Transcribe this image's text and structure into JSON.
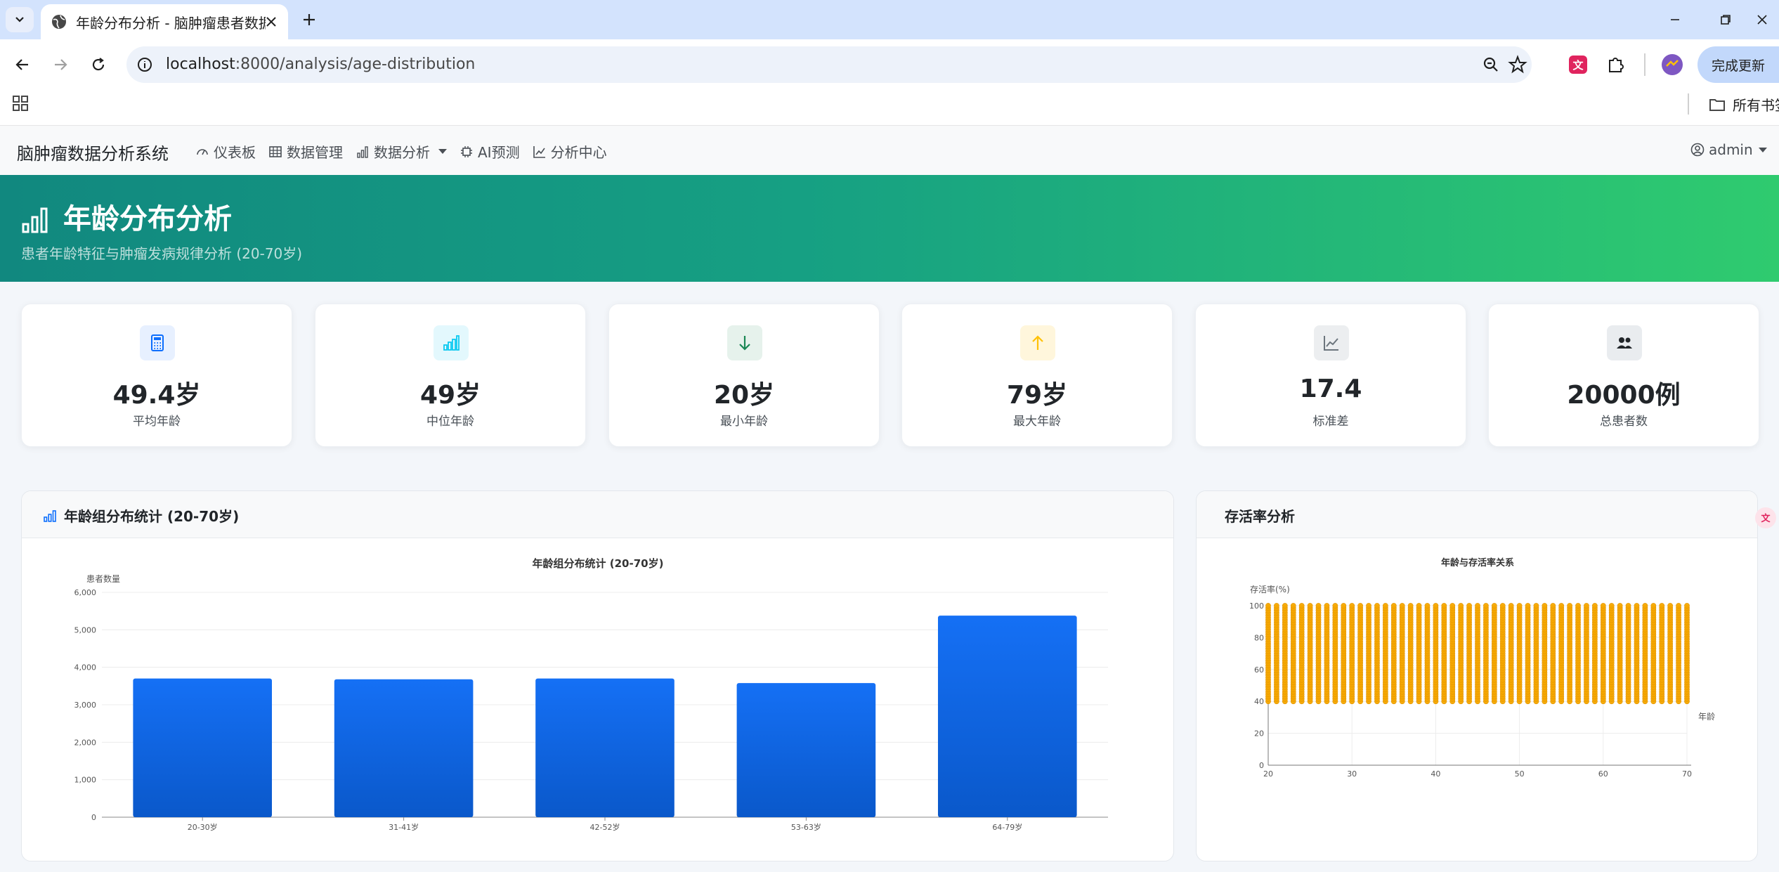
{
  "browser": {
    "tab_title": "年龄分布分析 - 脑肿瘤患者数据",
    "url_host": "localhost",
    "url_path": ":8000/analysis/age-distribution",
    "update_button": "完成更新",
    "bookmarks_folder": "所有书签"
  },
  "navbar": {
    "brand": "脑肿瘤数据分析系统",
    "links": [
      "仪表板",
      "数据管理",
      "数据分析",
      "AI预测",
      "分析中心"
    ],
    "user": "admin"
  },
  "hero": {
    "title": "年龄分布分析",
    "subtitle": "患者年龄特征与肿瘤发病规律分析 (20-70岁)"
  },
  "stats": [
    {
      "value": "49.4岁",
      "label": "平均年龄",
      "icon": "calculator-icon",
      "color": "#0d6efd",
      "bg": "#e7f0ff"
    },
    {
      "value": "49岁",
      "label": "中位年龄",
      "icon": "bar-chart-icon",
      "color": "#0dcaf0",
      "bg": "#e3f8fd"
    },
    {
      "value": "20岁",
      "label": "最小年龄",
      "icon": "arrow-down-icon",
      "color": "#198754",
      "bg": "#e6f2ec"
    },
    {
      "value": "79岁",
      "label": "最大年龄",
      "icon": "arrow-up-icon",
      "color": "#ffc107",
      "bg": "#fff6dc"
    },
    {
      "value": "17.4",
      "label": "标准差",
      "icon": "line-chart-icon",
      "color": "#6c757d",
      "bg": "#eceef0"
    },
    {
      "value": "20000例",
      "label": "总患者数",
      "icon": "people-icon",
      "color": "#212529",
      "bg": "#e9ecef"
    }
  ],
  "cards": {
    "age_group_title": "年龄组分布统计 (20-70岁)",
    "survival_title": "存活率分析"
  },
  "chart_data": [
    {
      "type": "bar",
      "title": "年龄组分布统计 (20-70岁)",
      "ylabel": "患者数量",
      "categories": [
        "20-30岁",
        "31-41岁",
        "42-52岁",
        "53-63岁",
        "64-79岁"
      ],
      "values": [
        3700,
        3680,
        3700,
        3580,
        5380
      ],
      "ylim": [
        0,
        6000
      ],
      "yticks": [
        "0",
        "1,000",
        "2,000",
        "3,000",
        "4,000",
        "5,000",
        "6,000"
      ],
      "bar_color_top": "#1570f5",
      "bar_color_bottom": "#0a58ca",
      "grid": true
    },
    {
      "type": "scatter",
      "title": "年龄与存活率关系",
      "xlabel": "年龄",
      "ylabel": "存活率(%)",
      "xlim": [
        20,
        70
      ],
      "ylim": [
        0,
        100
      ],
      "xticks": [
        "20",
        "30",
        "40",
        "50",
        "60",
        "70"
      ],
      "yticks": [
        "0",
        "20",
        "40",
        "60",
        "80",
        "100"
      ],
      "x_ages_from": 20,
      "x_ages_to": 70,
      "survival_range": [
        40,
        100
      ],
      "point_color": "#f5a800",
      "point_edge": "#e39400"
    }
  ]
}
